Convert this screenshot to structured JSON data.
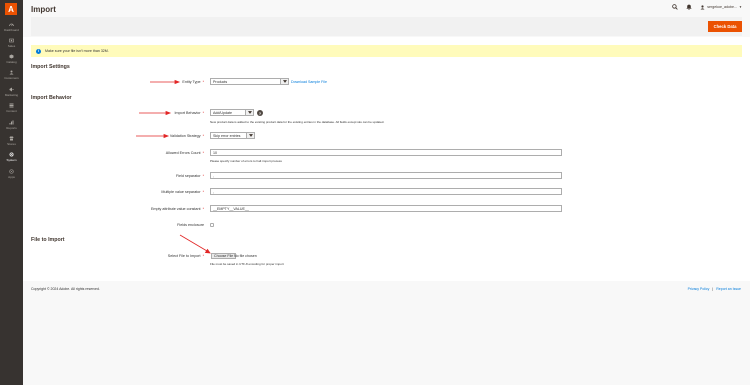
{
  "sidebar": {
    "logo_letter": "A",
    "items": [
      {
        "label": "Dashboard",
        "icon": "dashboard-icon"
      },
      {
        "label": "Sales",
        "icon": "dollar-icon"
      },
      {
        "label": "Catalog",
        "icon": "cube-icon"
      },
      {
        "label": "Customers",
        "icon": "people-icon"
      },
      {
        "label": "Marketing",
        "icon": "megaphone-icon"
      },
      {
        "label": "Content",
        "icon": "layout-icon"
      },
      {
        "label": "Reports",
        "icon": "bar-chart-icon"
      },
      {
        "label": "Stores",
        "icon": "store-icon"
      },
      {
        "label": "System",
        "icon": "gear-icon"
      },
      {
        "label": "Apps",
        "icon": "puzzle-icon"
      }
    ],
    "active": "System"
  },
  "header": {
    "title": "Import",
    "user_name": "sergekoe_adobe..."
  },
  "actions": {
    "check_data_label": "Check Data"
  },
  "notice": {
    "text": "Make sure your file isn't more than 32M."
  },
  "import_settings": {
    "title": "Import Settings",
    "entity_type_label": "Entity Type",
    "entity_type_value": "Products",
    "download_sample": "Download Sample File"
  },
  "import_behavior": {
    "title": "Import Behavior",
    "behavior_label": "Import Behavior",
    "behavior_value": "Add/Update",
    "behavior_help": "New product data is added to the existing product data for the existing entries in the database. All fields except sku can be updated.",
    "validation_label": "Validation Strategy",
    "validation_value": "Skip error entries",
    "allowed_errors_label": "Allowed Errors Count",
    "allowed_errors_value": "10",
    "allowed_errors_help": "Please specify number of errors to halt import process",
    "field_sep_label": "Field separator",
    "field_sep_value": ",",
    "multi_sep_label": "Multiple value separator",
    "multi_sep_value": ",",
    "empty_attr_label": "Empty attribute value constant",
    "empty_attr_value": "__EMPTY__VALUE__",
    "enclosure_label": "Fields enclosure"
  },
  "file_to_import": {
    "title": "File to Import",
    "select_label": "Select File to Import",
    "choose_btn": "Choose File",
    "no_file": "No file chosen",
    "help": "File must be saved in UTF-8 encoding for proper import"
  },
  "footer": {
    "copyright": "Copyright © 2024 Adobe. All rights reserved.",
    "privacy": "Privacy Policy",
    "separator": "|",
    "report": "Report an Issue"
  },
  "colors": {
    "accent": "#eb5202",
    "sidebar": "#373330",
    "link": "#007bdb",
    "notice_bg": "#fffbbb",
    "annotation_arrow": "#e22626"
  }
}
